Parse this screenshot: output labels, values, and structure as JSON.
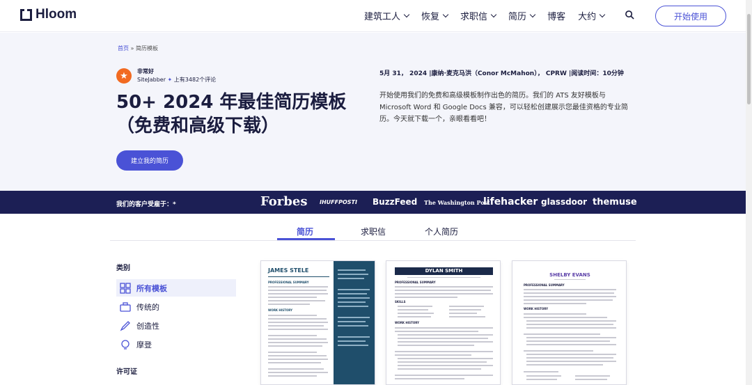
{
  "nav": {
    "logo": "Hloom",
    "items": [
      {
        "label": "建筑工人",
        "dropdown": true
      },
      {
        "label": "恢复",
        "dropdown": true
      },
      {
        "label": "求职信",
        "dropdown": true
      },
      {
        "label": "简历",
        "dropdown": true
      },
      {
        "label": "博客",
        "dropdown": false
      },
      {
        "label": "大约",
        "dropdown": true
      }
    ],
    "cta": "开始使用"
  },
  "breadcrumb": {
    "home": "首页",
    "sep": "»",
    "current": "简历模板"
  },
  "rating": {
    "label": "非常好",
    "source": "SiteJabber",
    "count": "上有3482个评论"
  },
  "hero": {
    "title_line1": "50+ 2024 年最佳简历模板",
    "title_line2": "（免费和高级下载）",
    "cta": "建立我的简历",
    "byline": "5月 31， 2024 |康纳·麦克马洪（Conor McMahon）， CPRW |阅读时间：10分钟",
    "description": "开始使用我们的免费和高级模板制作出色的简历。我们的 ATS 友好模板与 Microsoft Word 和 Google Docs 兼容，可以轻松创建展示您最佳资格的专业简历。今天就下载一个，亲眼看看吧！"
  },
  "press": {
    "label": "我们的客户受雇于：*",
    "logos": [
      "Forbes",
      "IHUFFPOSTI",
      "BuzzFeed",
      "The Washington Post",
      "lifehacker",
      "glassdoor",
      "themuse"
    ]
  },
  "tabs": [
    {
      "label": "简历",
      "active": true
    },
    {
      "label": "求职信",
      "active": false
    },
    {
      "label": "个人简历",
      "active": false
    }
  ],
  "sidebar": {
    "title": "类别",
    "items": [
      {
        "label": "所有模板",
        "icon": "grid-icon",
        "active": true
      },
      {
        "label": "传统的",
        "icon": "briefcase-icon",
        "active": false
      },
      {
        "label": "创造性",
        "icon": "pen-icon",
        "active": false
      },
      {
        "label": "摩登",
        "icon": "bulb-icon",
        "active": false
      }
    ],
    "license_title": "许可证"
  },
  "cards": [
    {
      "name": "JAMES STELE",
      "section1": "PROFESSIONAL SUMMARY",
      "section2": "WORK HISTORY"
    },
    {
      "name": "DYLAN SMITH",
      "section1": "PROFESSIONAL SUMMARY",
      "section2": "SKILLS",
      "section3": "WORK HISTORY"
    },
    {
      "name": "SHELBY EVANS",
      "section1": "PROFESSIONAL SUMMARY",
      "section2": "WORK HISTORY"
    }
  ],
  "colors": {
    "accent": "#4a52d6",
    "navy": "#1c1f55",
    "orange": "#f26a21",
    "hero_bg": "#f4f5fb"
  }
}
